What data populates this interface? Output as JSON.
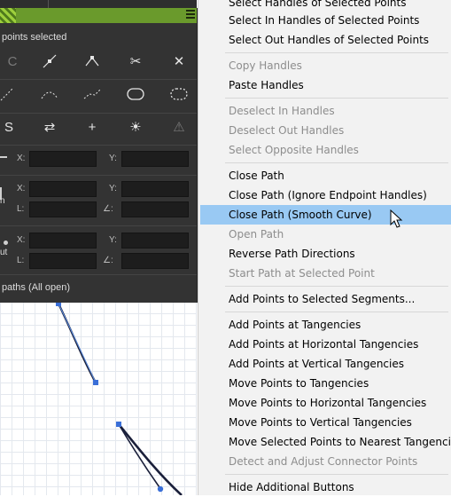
{
  "panel": {
    "status": "points selected",
    "x_label": "X:",
    "y_label": "Y:",
    "l_label": "L:",
    "angle_label": "∠:",
    "row_labels": {
      "mid": "n",
      "out": "ut"
    },
    "left_labels": {
      "c": "C",
      "s": "S"
    },
    "paths_status": "paths (All open)",
    "icons_row1": [
      "curve-handle-icon",
      "corner-handle-icon",
      "scissors-icon",
      "remove-point-icon"
    ],
    "icons_row2": [
      "path-points-icon",
      "bezier-curve-icon",
      "smooth-points-icon",
      "ellipse-path-icon",
      "ellipse-points-icon"
    ],
    "icons_row3": [
      "swap-direction-icon",
      "add-icon",
      "tangent-point-icon",
      "warning-icon"
    ]
  },
  "menu": {
    "items": [
      {
        "label": "Select Handles of Selected Points",
        "enabled": true
      },
      {
        "label": "Select In Handles of Selected Points",
        "enabled": true
      },
      {
        "label": "Select Out Handles of Selected Points",
        "enabled": true
      },
      {
        "label": "Copy Handles",
        "enabled": false
      },
      {
        "label": "Paste Handles",
        "enabled": true
      },
      {
        "label": "Deselect In Handles",
        "enabled": false
      },
      {
        "label": "Deselect Out Handles",
        "enabled": false
      },
      {
        "label": "Select Opposite Handles",
        "enabled": false
      },
      {
        "label": "Close Path",
        "enabled": true
      },
      {
        "label": "Close Path (Ignore Endpoint Handles)",
        "enabled": true
      },
      {
        "label": "Close Path (Smooth Curve)",
        "enabled": true,
        "highlighted": true
      },
      {
        "label": "Open Path",
        "enabled": false
      },
      {
        "label": "Reverse Path Directions",
        "enabled": true
      },
      {
        "label": "Start Path at Selected Point",
        "enabled": false
      },
      {
        "label": "Add Points to Selected Segments...",
        "enabled": true
      },
      {
        "label": "Add Points at Tangencies",
        "enabled": true
      },
      {
        "label": "Add Points at Horizontal Tangencies",
        "enabled": true
      },
      {
        "label": "Add Points at Vertical Tangencies",
        "enabled": true
      },
      {
        "label": "Move Points to Tangencies",
        "enabled": true
      },
      {
        "label": "Move Points to Horizontal Tangencies",
        "enabled": true
      },
      {
        "label": "Move Points to Vertical Tangencies",
        "enabled": true
      },
      {
        "label": "Move Selected Points to Nearest Tangencies",
        "enabled": true
      },
      {
        "label": "Detect and Adjust Connector Points",
        "enabled": false
      },
      {
        "label": "Hide Additional Buttons",
        "enabled": true
      }
    ],
    "highlight_color": "#99c9f3",
    "disabled_color": "#8d8d8d"
  },
  "colors": {
    "panel_bg": "#333333",
    "header_green": "#6a9a2c",
    "path_stroke": "#1a1f3a",
    "anchor_blue": "#3a6fd8"
  }
}
